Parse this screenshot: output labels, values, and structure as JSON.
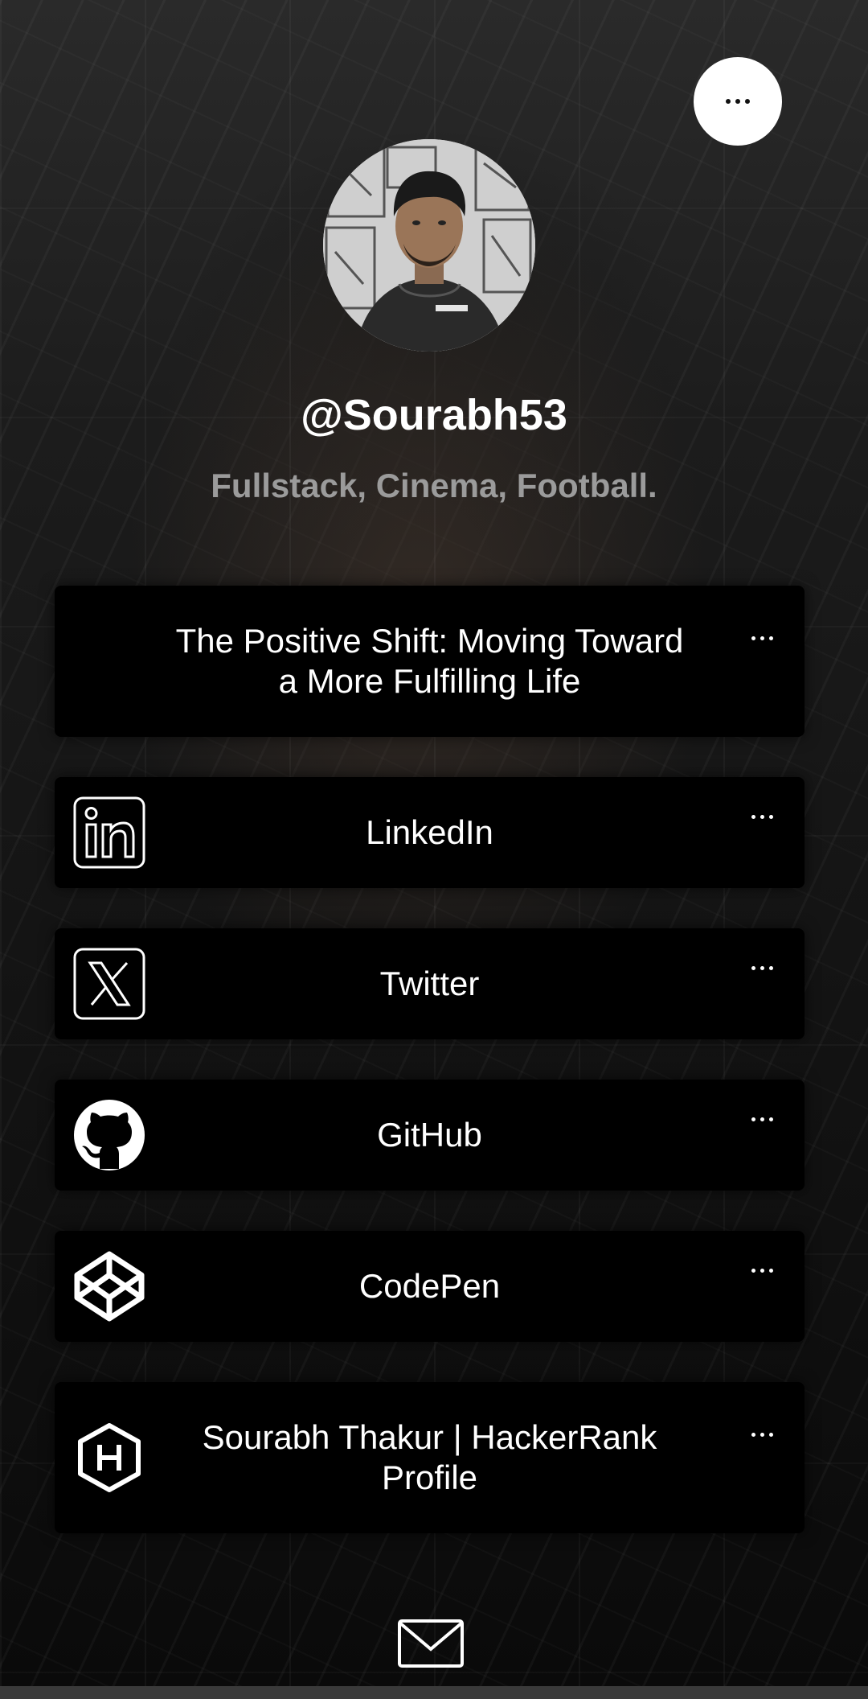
{
  "profile": {
    "username": "@Sourabh53",
    "bio": "Fullstack, Cinema, Football."
  },
  "links": [
    {
      "label": "The Positive Shift: Moving Toward a More Fulfilling Life",
      "icon": "none"
    },
    {
      "label": "LinkedIn",
      "icon": "linkedin-icon"
    },
    {
      "label": "Twitter",
      "icon": "x-twitter-icon"
    },
    {
      "label": "GitHub",
      "icon": "github-icon"
    },
    {
      "label": "CodePen",
      "icon": "codepen-icon"
    },
    {
      "label": "Sourabh Thakur | HackerRank Profile",
      "icon": "hackerrank-icon"
    }
  ],
  "colors": {
    "card_bg": "#000000",
    "text": "#ffffff",
    "bio_text": "#9b9b9b",
    "more_button_bg": "#ffffff"
  },
  "footer": {
    "icon": "mail-icon"
  }
}
